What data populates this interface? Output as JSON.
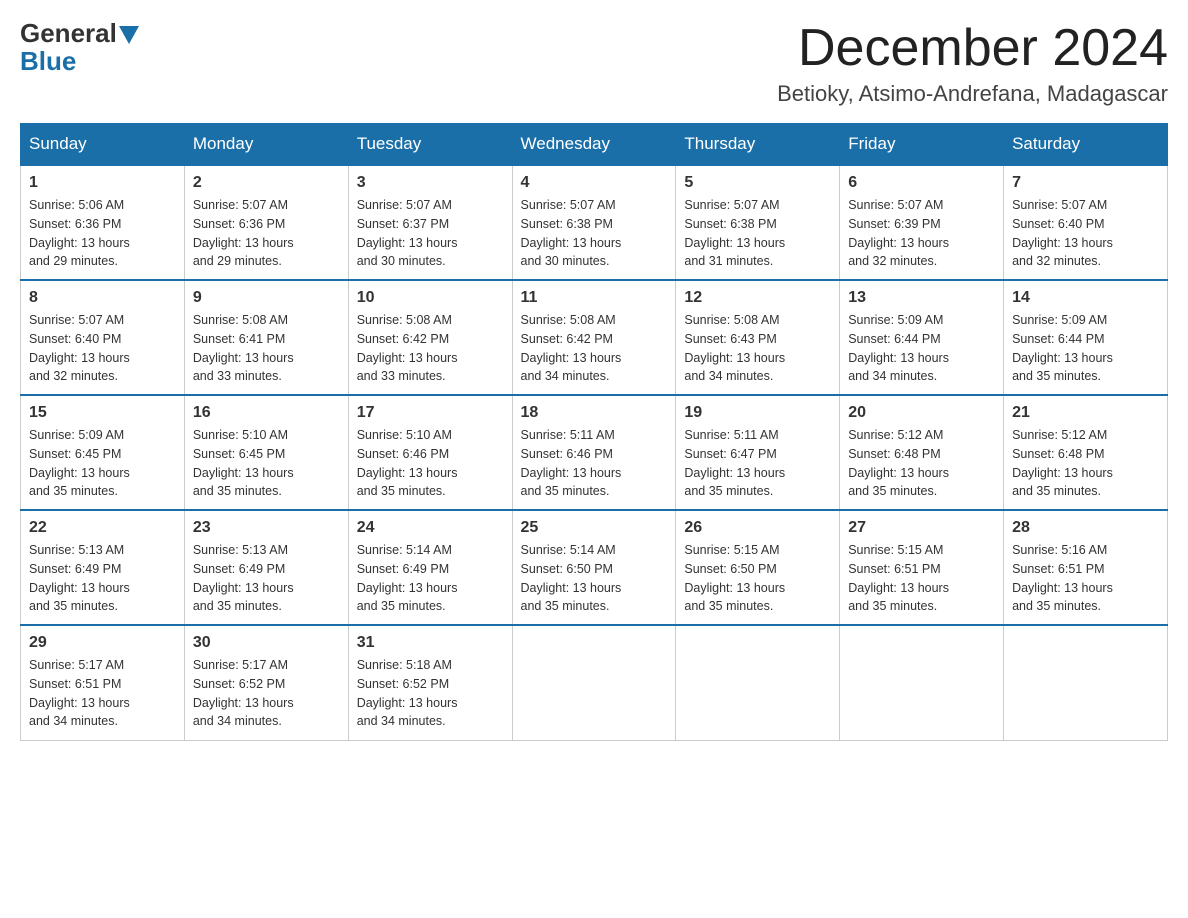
{
  "logo": {
    "general": "General",
    "blue": "Blue"
  },
  "header": {
    "month_year": "December 2024",
    "location": "Betioky, Atsimo-Andrefana, Madagascar"
  },
  "days_of_week": [
    "Sunday",
    "Monday",
    "Tuesday",
    "Wednesday",
    "Thursday",
    "Friday",
    "Saturday"
  ],
  "weeks": [
    [
      {
        "day": "1",
        "sunrise": "5:06 AM",
        "sunset": "6:36 PM",
        "daylight": "13 hours and 29 minutes."
      },
      {
        "day": "2",
        "sunrise": "5:07 AM",
        "sunset": "6:36 PM",
        "daylight": "13 hours and 29 minutes."
      },
      {
        "day": "3",
        "sunrise": "5:07 AM",
        "sunset": "6:37 PM",
        "daylight": "13 hours and 30 minutes."
      },
      {
        "day": "4",
        "sunrise": "5:07 AM",
        "sunset": "6:38 PM",
        "daylight": "13 hours and 30 minutes."
      },
      {
        "day": "5",
        "sunrise": "5:07 AM",
        "sunset": "6:38 PM",
        "daylight": "13 hours and 31 minutes."
      },
      {
        "day": "6",
        "sunrise": "5:07 AM",
        "sunset": "6:39 PM",
        "daylight": "13 hours and 32 minutes."
      },
      {
        "day": "7",
        "sunrise": "5:07 AM",
        "sunset": "6:40 PM",
        "daylight": "13 hours and 32 minutes."
      }
    ],
    [
      {
        "day": "8",
        "sunrise": "5:07 AM",
        "sunset": "6:40 PM",
        "daylight": "13 hours and 32 minutes."
      },
      {
        "day": "9",
        "sunrise": "5:08 AM",
        "sunset": "6:41 PM",
        "daylight": "13 hours and 33 minutes."
      },
      {
        "day": "10",
        "sunrise": "5:08 AM",
        "sunset": "6:42 PM",
        "daylight": "13 hours and 33 minutes."
      },
      {
        "day": "11",
        "sunrise": "5:08 AM",
        "sunset": "6:42 PM",
        "daylight": "13 hours and 34 minutes."
      },
      {
        "day": "12",
        "sunrise": "5:08 AM",
        "sunset": "6:43 PM",
        "daylight": "13 hours and 34 minutes."
      },
      {
        "day": "13",
        "sunrise": "5:09 AM",
        "sunset": "6:44 PM",
        "daylight": "13 hours and 34 minutes."
      },
      {
        "day": "14",
        "sunrise": "5:09 AM",
        "sunset": "6:44 PM",
        "daylight": "13 hours and 35 minutes."
      }
    ],
    [
      {
        "day": "15",
        "sunrise": "5:09 AM",
        "sunset": "6:45 PM",
        "daylight": "13 hours and 35 minutes."
      },
      {
        "day": "16",
        "sunrise": "5:10 AM",
        "sunset": "6:45 PM",
        "daylight": "13 hours and 35 minutes."
      },
      {
        "day": "17",
        "sunrise": "5:10 AM",
        "sunset": "6:46 PM",
        "daylight": "13 hours and 35 minutes."
      },
      {
        "day": "18",
        "sunrise": "5:11 AM",
        "sunset": "6:46 PM",
        "daylight": "13 hours and 35 minutes."
      },
      {
        "day": "19",
        "sunrise": "5:11 AM",
        "sunset": "6:47 PM",
        "daylight": "13 hours and 35 minutes."
      },
      {
        "day": "20",
        "sunrise": "5:12 AM",
        "sunset": "6:48 PM",
        "daylight": "13 hours and 35 minutes."
      },
      {
        "day": "21",
        "sunrise": "5:12 AM",
        "sunset": "6:48 PM",
        "daylight": "13 hours and 35 minutes."
      }
    ],
    [
      {
        "day": "22",
        "sunrise": "5:13 AM",
        "sunset": "6:49 PM",
        "daylight": "13 hours and 35 minutes."
      },
      {
        "day": "23",
        "sunrise": "5:13 AM",
        "sunset": "6:49 PM",
        "daylight": "13 hours and 35 minutes."
      },
      {
        "day": "24",
        "sunrise": "5:14 AM",
        "sunset": "6:49 PM",
        "daylight": "13 hours and 35 minutes."
      },
      {
        "day": "25",
        "sunrise": "5:14 AM",
        "sunset": "6:50 PM",
        "daylight": "13 hours and 35 minutes."
      },
      {
        "day": "26",
        "sunrise": "5:15 AM",
        "sunset": "6:50 PM",
        "daylight": "13 hours and 35 minutes."
      },
      {
        "day": "27",
        "sunrise": "5:15 AM",
        "sunset": "6:51 PM",
        "daylight": "13 hours and 35 minutes."
      },
      {
        "day": "28",
        "sunrise": "5:16 AM",
        "sunset": "6:51 PM",
        "daylight": "13 hours and 35 minutes."
      }
    ],
    [
      {
        "day": "29",
        "sunrise": "5:17 AM",
        "sunset": "6:51 PM",
        "daylight": "13 hours and 34 minutes."
      },
      {
        "day": "30",
        "sunrise": "5:17 AM",
        "sunset": "6:52 PM",
        "daylight": "13 hours and 34 minutes."
      },
      {
        "day": "31",
        "sunrise": "5:18 AM",
        "sunset": "6:52 PM",
        "daylight": "13 hours and 34 minutes."
      },
      null,
      null,
      null,
      null
    ]
  ],
  "labels": {
    "sunrise_prefix": "Sunrise: ",
    "sunset_prefix": "Sunset: ",
    "daylight_prefix": "Daylight: "
  }
}
